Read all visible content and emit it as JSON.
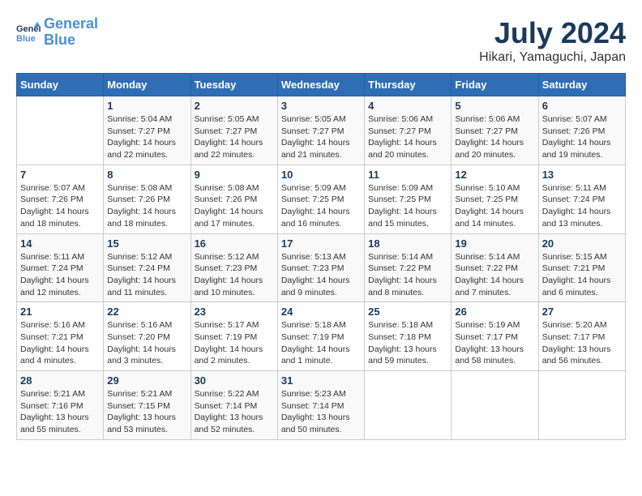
{
  "logo": {
    "line1": "General",
    "line2": "Blue"
  },
  "title": "July 2024",
  "subtitle": "Hikari, Yamaguchi, Japan",
  "days_of_week": [
    "Sunday",
    "Monday",
    "Tuesday",
    "Wednesday",
    "Thursday",
    "Friday",
    "Saturday"
  ],
  "weeks": [
    [
      {
        "day": "",
        "info": ""
      },
      {
        "day": "1",
        "info": "Sunrise: 5:04 AM\nSunset: 7:27 PM\nDaylight: 14 hours\nand 22 minutes."
      },
      {
        "day": "2",
        "info": "Sunrise: 5:05 AM\nSunset: 7:27 PM\nDaylight: 14 hours\nand 22 minutes."
      },
      {
        "day": "3",
        "info": "Sunrise: 5:05 AM\nSunset: 7:27 PM\nDaylight: 14 hours\nand 21 minutes."
      },
      {
        "day": "4",
        "info": "Sunrise: 5:06 AM\nSunset: 7:27 PM\nDaylight: 14 hours\nand 20 minutes."
      },
      {
        "day": "5",
        "info": "Sunrise: 5:06 AM\nSunset: 7:27 PM\nDaylight: 14 hours\nand 20 minutes."
      },
      {
        "day": "6",
        "info": "Sunrise: 5:07 AM\nSunset: 7:26 PM\nDaylight: 14 hours\nand 19 minutes."
      }
    ],
    [
      {
        "day": "7",
        "info": "Sunrise: 5:07 AM\nSunset: 7:26 PM\nDaylight: 14 hours\nand 18 minutes."
      },
      {
        "day": "8",
        "info": "Sunrise: 5:08 AM\nSunset: 7:26 PM\nDaylight: 14 hours\nand 18 minutes."
      },
      {
        "day": "9",
        "info": "Sunrise: 5:08 AM\nSunset: 7:26 PM\nDaylight: 14 hours\nand 17 minutes."
      },
      {
        "day": "10",
        "info": "Sunrise: 5:09 AM\nSunset: 7:25 PM\nDaylight: 14 hours\nand 16 minutes."
      },
      {
        "day": "11",
        "info": "Sunrise: 5:09 AM\nSunset: 7:25 PM\nDaylight: 14 hours\nand 15 minutes."
      },
      {
        "day": "12",
        "info": "Sunrise: 5:10 AM\nSunset: 7:25 PM\nDaylight: 14 hours\nand 14 minutes."
      },
      {
        "day": "13",
        "info": "Sunrise: 5:11 AM\nSunset: 7:24 PM\nDaylight: 14 hours\nand 13 minutes."
      }
    ],
    [
      {
        "day": "14",
        "info": "Sunrise: 5:11 AM\nSunset: 7:24 PM\nDaylight: 14 hours\nand 12 minutes."
      },
      {
        "day": "15",
        "info": "Sunrise: 5:12 AM\nSunset: 7:24 PM\nDaylight: 14 hours\nand 11 minutes."
      },
      {
        "day": "16",
        "info": "Sunrise: 5:12 AM\nSunset: 7:23 PM\nDaylight: 14 hours\nand 10 minutes."
      },
      {
        "day": "17",
        "info": "Sunrise: 5:13 AM\nSunset: 7:23 PM\nDaylight: 14 hours\nand 9 minutes."
      },
      {
        "day": "18",
        "info": "Sunrise: 5:14 AM\nSunset: 7:22 PM\nDaylight: 14 hours\nand 8 minutes."
      },
      {
        "day": "19",
        "info": "Sunrise: 5:14 AM\nSunset: 7:22 PM\nDaylight: 14 hours\nand 7 minutes."
      },
      {
        "day": "20",
        "info": "Sunrise: 5:15 AM\nSunset: 7:21 PM\nDaylight: 14 hours\nand 6 minutes."
      }
    ],
    [
      {
        "day": "21",
        "info": "Sunrise: 5:16 AM\nSunset: 7:21 PM\nDaylight: 14 hours\nand 4 minutes."
      },
      {
        "day": "22",
        "info": "Sunrise: 5:16 AM\nSunset: 7:20 PM\nDaylight: 14 hours\nand 3 minutes."
      },
      {
        "day": "23",
        "info": "Sunrise: 5:17 AM\nSunset: 7:19 PM\nDaylight: 14 hours\nand 2 minutes."
      },
      {
        "day": "24",
        "info": "Sunrise: 5:18 AM\nSunset: 7:19 PM\nDaylight: 14 hours\nand 1 minute."
      },
      {
        "day": "25",
        "info": "Sunrise: 5:18 AM\nSunset: 7:18 PM\nDaylight: 13 hours\nand 59 minutes."
      },
      {
        "day": "26",
        "info": "Sunrise: 5:19 AM\nSunset: 7:17 PM\nDaylight: 13 hours\nand 58 minutes."
      },
      {
        "day": "27",
        "info": "Sunrise: 5:20 AM\nSunset: 7:17 PM\nDaylight: 13 hours\nand 56 minutes."
      }
    ],
    [
      {
        "day": "28",
        "info": "Sunrise: 5:21 AM\nSunset: 7:16 PM\nDaylight: 13 hours\nand 55 minutes."
      },
      {
        "day": "29",
        "info": "Sunrise: 5:21 AM\nSunset: 7:15 PM\nDaylight: 13 hours\nand 53 minutes."
      },
      {
        "day": "30",
        "info": "Sunrise: 5:22 AM\nSunset: 7:14 PM\nDaylight: 13 hours\nand 52 minutes."
      },
      {
        "day": "31",
        "info": "Sunrise: 5:23 AM\nSunset: 7:14 PM\nDaylight: 13 hours\nand 50 minutes."
      },
      {
        "day": "",
        "info": ""
      },
      {
        "day": "",
        "info": ""
      },
      {
        "day": "",
        "info": ""
      }
    ]
  ]
}
